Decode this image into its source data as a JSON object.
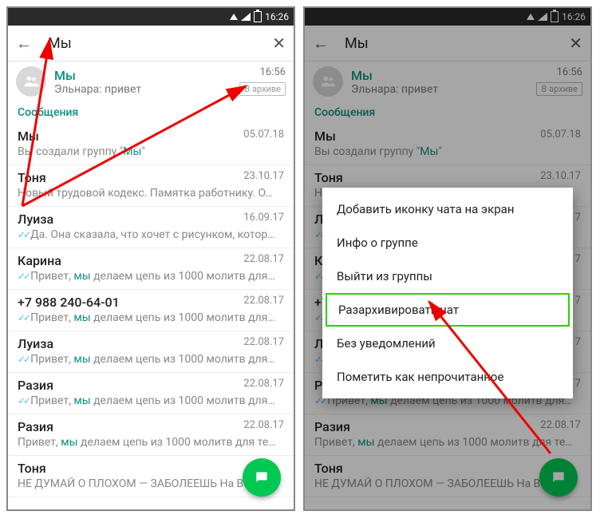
{
  "status": {
    "time": "16:26"
  },
  "search": {
    "query": "Мы"
  },
  "pinned": {
    "name": "Мы",
    "preview": "Эльнара: привет",
    "time": "16:56",
    "badge": "В архиве"
  },
  "section": "Сообщения",
  "chats": [
    {
      "name": "Мы",
      "date": "05.07.18",
      "preview_pre": "Вы создали группу \"",
      "preview_hl": "Мы",
      "preview_post": "\"",
      "ticks": false
    },
    {
      "name": "Тоня",
      "date": "23.10.17",
      "preview_pre": "Новый трудовой кодекс. Памятка работнику.  О…",
      "preview_hl": "",
      "preview_post": "",
      "ticks": false
    },
    {
      "name": "Луиза",
      "date": "16.09.17",
      "preview_pre": "Да. Она сказала, что хочет с рисунком, котор…",
      "preview_hl": "",
      "preview_post": "",
      "ticks": true
    },
    {
      "name": "Карина",
      "date": "22.08.17",
      "preview_pre": "Привет, ",
      "preview_hl": "мы",
      "preview_post": " делаем цепь из 1000 молитв для…",
      "ticks": true
    },
    {
      "name": "+7 988 240-64-01",
      "date": "22.08.17",
      "preview_pre": "Привет, ",
      "preview_hl": "мы",
      "preview_post": " делаем цепь из 1000 молитв для…",
      "ticks": true
    },
    {
      "name": "Луиза",
      "date": "22.08.17",
      "preview_pre": "Привет, ",
      "preview_hl": "мы",
      "preview_post": " делаем цепь из 1000 молитв для…",
      "ticks": true
    },
    {
      "name": "Разия",
      "date": "22.08.17",
      "preview_pre": "Привет, ",
      "preview_hl": "мы",
      "preview_post": " делаем цепь из 1000 молитв для…",
      "ticks": true
    },
    {
      "name": "Разия",
      "date": "22.08.17",
      "preview_pre": "Привет, ",
      "preview_hl": "мы",
      "preview_post": " делаем цепь из 1000 молитв для те…",
      "ticks": false
    },
    {
      "name": "Тоня",
      "date": "",
      "preview_pre": "НЕ ДУМАЙ О ПЛОХОМ — ЗАБОЛЕЕШЬ  На Вост",
      "preview_hl": "",
      "preview_post": "",
      "ticks": false
    }
  ],
  "menu": {
    "items": [
      "Добавить иконку чата на экран",
      "Инфо о группе",
      "Выйти из группы",
      "Разархивировать чат",
      "Без уведомлений",
      "Пометить как непрочитанное"
    ],
    "highlight_index": 3
  }
}
